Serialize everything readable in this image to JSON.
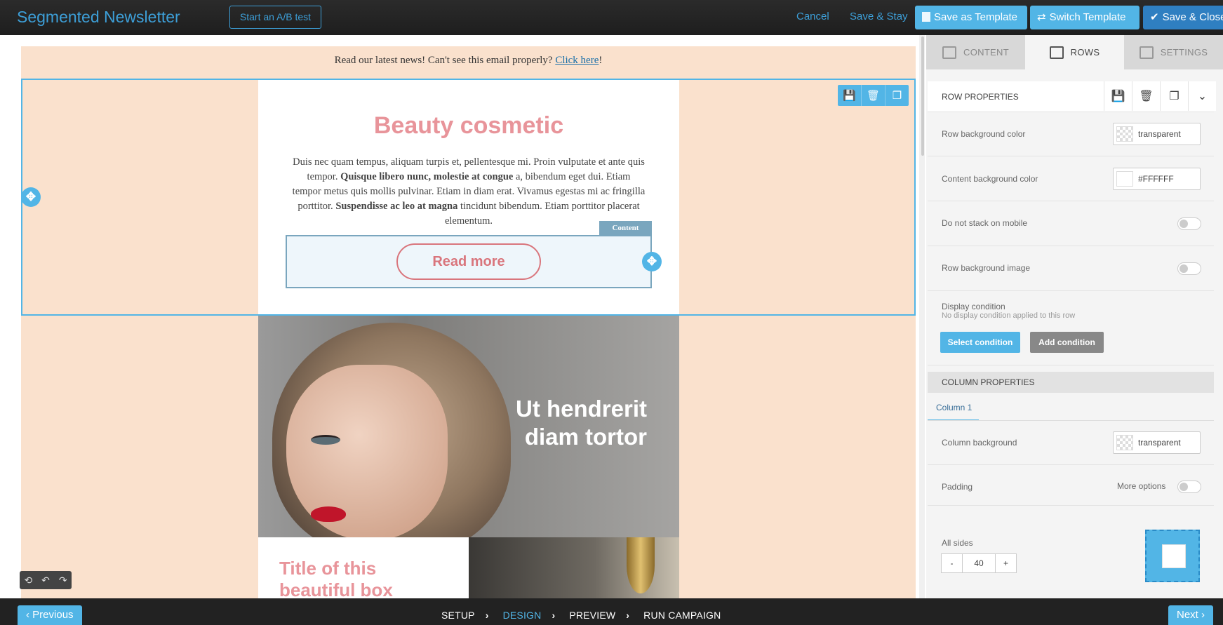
{
  "app": {
    "title": "Segmented Newsletter",
    "ab_test_label": "Start an A/B test",
    "cancel_label": "Cancel",
    "save_stay_label": "Save & Stay",
    "save_template_label": "Save as Template",
    "switch_template_label": "Switch Template",
    "save_close_label": "Save & Close",
    "colors": {
      "accent": "#3d9fd8",
      "button": "#52b5e6",
      "save_close": "#2f7fc1"
    }
  },
  "email": {
    "preheader_text": "Read our latest news! Can't see this email properly?",
    "preheader_link": "Click here",
    "preheader_suffix": "!",
    "card_title": "Beauty cosmetic",
    "card_body_1": "Duis nec quam tempus, aliquam turpis et, pellentesque mi. Proin vulputate et ante quis tempor. ",
    "card_body_bold_1": "Quisque libero nunc, molestie at congue",
    "card_body_2": " a, bibendum eget dui. Etiam tempor metus quis mollis pulvinar. Etiam in diam erat. Vivamus egestas mi ac fringilla porttitor. ",
    "card_body_bold_2": "Suspendisse ac leo at magna",
    "card_body_3": " tincidunt bibendum. Etiam porttitor placerat elementum.",
    "content_tag": "Content",
    "button_label": "Read more",
    "hero_text_1": "Ut hendrerit",
    "hero_text_2": "diam tortor",
    "box_title_1": "Title of this",
    "box_title_2": "beautiful box",
    "colors": {
      "background": "#fae1cd",
      "title": "#e8949a",
      "button": "#d9757c"
    }
  },
  "panel": {
    "tabs": [
      "CONTENT",
      "ROWS",
      "SETTINGS"
    ],
    "active_tab": "ROWS",
    "row_properties": {
      "title": "ROW PROPERTIES",
      "row_bg_label": "Row background color",
      "row_bg_value": "transparent",
      "content_bg_label": "Content background color",
      "content_bg_value": "#FFFFFF",
      "no_stack_label": "Do not stack on mobile",
      "no_stack_on": false,
      "bg_image_label": "Row background image",
      "bg_image_on": false,
      "display_condition_label": "Display condition",
      "display_condition_value": "No display condition applied to this row",
      "select_condition_label": "Select condition",
      "add_condition_label": "Add condition"
    },
    "column_properties": {
      "title": "COLUMN PROPERTIES",
      "column_tab": "Column 1",
      "column_bg_label": "Column background",
      "column_bg_value": "transparent",
      "padding_label": "Padding",
      "more_options_label": "More options",
      "more_options_on": false,
      "all_sides_label": "All sides",
      "padding_value": "40",
      "minus": "-",
      "plus": "+"
    }
  },
  "footer": {
    "previous_label": "Previous",
    "next_label": "Next",
    "steps": [
      "SETUP",
      "DESIGN",
      "PREVIEW",
      "RUN CAMPAIGN"
    ],
    "active_step": "DESIGN"
  }
}
